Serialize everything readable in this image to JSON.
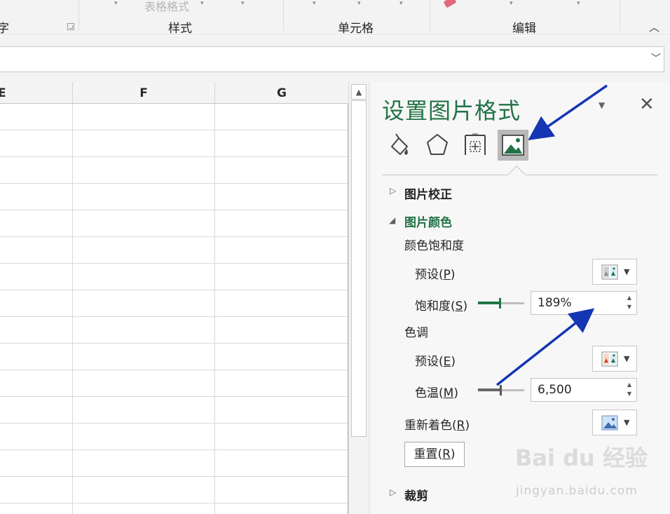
{
  "ribbon": {
    "group_font_fragment": "字",
    "group_styles": "样式",
    "group_cells": "单元格",
    "group_editing": "编辑",
    "table_format_faded": "表格格式"
  },
  "columns": [
    "E",
    "F",
    "G"
  ],
  "rows": 16,
  "panel": {
    "title": "设置图片格式",
    "tabs": [
      {
        "name": "fill-line",
        "icon": "paint-bucket-icon"
      },
      {
        "name": "effects",
        "icon": "pentagon-icon"
      },
      {
        "name": "size-properties",
        "icon": "size-properties-icon"
      },
      {
        "name": "picture",
        "icon": "picture-icon",
        "active": true
      }
    ],
    "section_correction": "图片校正",
    "section_color": "图片颜色",
    "saturation_group": "颜色饱和度",
    "preset_p": {
      "text": "预设(",
      "key": "P",
      "end": ")"
    },
    "saturation": {
      "text": "饱和度(",
      "key": "S",
      "end": ")",
      "value": "189%",
      "level_percent": 189
    },
    "tone_group": "色调",
    "preset_e": {
      "text": "预设(",
      "key": "E",
      "end": ")"
    },
    "temperature": {
      "text": "色温(",
      "key": "M",
      "end": ")",
      "value": "6,500"
    },
    "recolor": {
      "text": "重新着色(",
      "key": "R",
      "end": ")"
    },
    "reset": {
      "text": "重置(",
      "key": "R",
      "end": ")"
    },
    "section_crop": "裁剪"
  },
  "watermark": {
    "logo": "Bai du 经验",
    "url": "jingyan.baidu.com"
  },
  "colors": {
    "accent": "#217346",
    "annotation_arrow": "#1436b4"
  }
}
